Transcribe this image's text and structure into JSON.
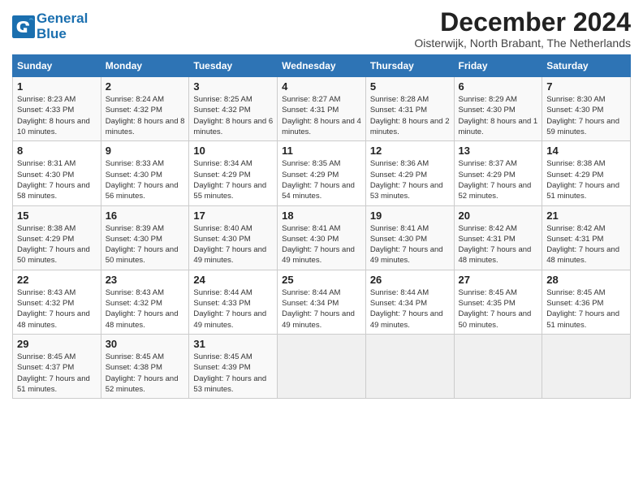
{
  "header": {
    "logo_line1": "General",
    "logo_line2": "Blue",
    "month": "December 2024",
    "location": "Oisterwijk, North Brabant, The Netherlands"
  },
  "days_of_week": [
    "Sunday",
    "Monday",
    "Tuesday",
    "Wednesday",
    "Thursday",
    "Friday",
    "Saturday"
  ],
  "weeks": [
    [
      {
        "day": "1",
        "sunrise": "8:23 AM",
        "sunset": "4:33 PM",
        "daylight": "8 hours and 10 minutes."
      },
      {
        "day": "2",
        "sunrise": "8:24 AM",
        "sunset": "4:32 PM",
        "daylight": "8 hours and 8 minutes."
      },
      {
        "day": "3",
        "sunrise": "8:25 AM",
        "sunset": "4:32 PM",
        "daylight": "8 hours and 6 minutes."
      },
      {
        "day": "4",
        "sunrise": "8:27 AM",
        "sunset": "4:31 PM",
        "daylight": "8 hours and 4 minutes."
      },
      {
        "day": "5",
        "sunrise": "8:28 AM",
        "sunset": "4:31 PM",
        "daylight": "8 hours and 2 minutes."
      },
      {
        "day": "6",
        "sunrise": "8:29 AM",
        "sunset": "4:30 PM",
        "daylight": "8 hours and 1 minute."
      },
      {
        "day": "7",
        "sunrise": "8:30 AM",
        "sunset": "4:30 PM",
        "daylight": "7 hours and 59 minutes."
      }
    ],
    [
      {
        "day": "8",
        "sunrise": "8:31 AM",
        "sunset": "4:30 PM",
        "daylight": "7 hours and 58 minutes."
      },
      {
        "day": "9",
        "sunrise": "8:33 AM",
        "sunset": "4:30 PM",
        "daylight": "7 hours and 56 minutes."
      },
      {
        "day": "10",
        "sunrise": "8:34 AM",
        "sunset": "4:29 PM",
        "daylight": "7 hours and 55 minutes."
      },
      {
        "day": "11",
        "sunrise": "8:35 AM",
        "sunset": "4:29 PM",
        "daylight": "7 hours and 54 minutes."
      },
      {
        "day": "12",
        "sunrise": "8:36 AM",
        "sunset": "4:29 PM",
        "daylight": "7 hours and 53 minutes."
      },
      {
        "day": "13",
        "sunrise": "8:37 AM",
        "sunset": "4:29 PM",
        "daylight": "7 hours and 52 minutes."
      },
      {
        "day": "14",
        "sunrise": "8:38 AM",
        "sunset": "4:29 PM",
        "daylight": "7 hours and 51 minutes."
      }
    ],
    [
      {
        "day": "15",
        "sunrise": "8:38 AM",
        "sunset": "4:29 PM",
        "daylight": "7 hours and 50 minutes."
      },
      {
        "day": "16",
        "sunrise": "8:39 AM",
        "sunset": "4:30 PM",
        "daylight": "7 hours and 50 minutes."
      },
      {
        "day": "17",
        "sunrise": "8:40 AM",
        "sunset": "4:30 PM",
        "daylight": "7 hours and 49 minutes."
      },
      {
        "day": "18",
        "sunrise": "8:41 AM",
        "sunset": "4:30 PM",
        "daylight": "7 hours and 49 minutes."
      },
      {
        "day": "19",
        "sunrise": "8:41 AM",
        "sunset": "4:30 PM",
        "daylight": "7 hours and 49 minutes."
      },
      {
        "day": "20",
        "sunrise": "8:42 AM",
        "sunset": "4:31 PM",
        "daylight": "7 hours and 48 minutes."
      },
      {
        "day": "21",
        "sunrise": "8:42 AM",
        "sunset": "4:31 PM",
        "daylight": "7 hours and 48 minutes."
      }
    ],
    [
      {
        "day": "22",
        "sunrise": "8:43 AM",
        "sunset": "4:32 PM",
        "daylight": "7 hours and 48 minutes."
      },
      {
        "day": "23",
        "sunrise": "8:43 AM",
        "sunset": "4:32 PM",
        "daylight": "7 hours and 48 minutes."
      },
      {
        "day": "24",
        "sunrise": "8:44 AM",
        "sunset": "4:33 PM",
        "daylight": "7 hours and 49 minutes."
      },
      {
        "day": "25",
        "sunrise": "8:44 AM",
        "sunset": "4:34 PM",
        "daylight": "7 hours and 49 minutes."
      },
      {
        "day": "26",
        "sunrise": "8:44 AM",
        "sunset": "4:34 PM",
        "daylight": "7 hours and 49 minutes."
      },
      {
        "day": "27",
        "sunrise": "8:45 AM",
        "sunset": "4:35 PM",
        "daylight": "7 hours and 50 minutes."
      },
      {
        "day": "28",
        "sunrise": "8:45 AM",
        "sunset": "4:36 PM",
        "daylight": "7 hours and 51 minutes."
      }
    ],
    [
      {
        "day": "29",
        "sunrise": "8:45 AM",
        "sunset": "4:37 PM",
        "daylight": "7 hours and 51 minutes."
      },
      {
        "day": "30",
        "sunrise": "8:45 AM",
        "sunset": "4:38 PM",
        "daylight": "7 hours and 52 minutes."
      },
      {
        "day": "31",
        "sunrise": "8:45 AM",
        "sunset": "4:39 PM",
        "daylight": "7 hours and 53 minutes."
      },
      null,
      null,
      null,
      null
    ]
  ]
}
